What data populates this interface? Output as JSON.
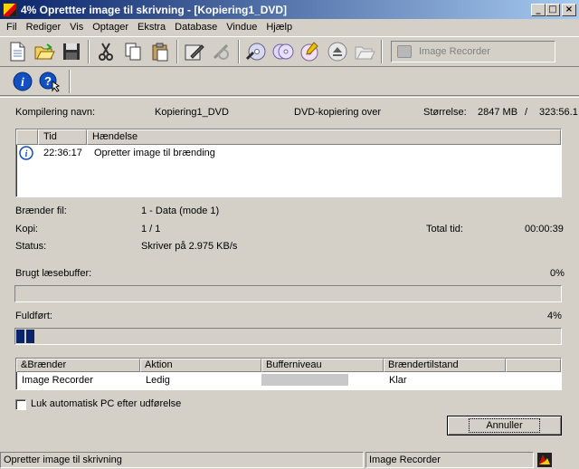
{
  "window": {
    "title": "4% Oprettter image til skrivning - [Kopiering1_DVD]"
  },
  "menu": [
    "Fil",
    "Rediger",
    "Vis",
    "Optager",
    "Ekstra",
    "Database",
    "Vindue",
    "Hjælp"
  ],
  "toolbar": {
    "recorder_label": "Image Recorder"
  },
  "info": {
    "compile_name_label": "Kompilering navn:",
    "compile_name_value": "Kopiering1_DVD",
    "mode_text": "DVD-kopiering over",
    "size_label": "Størrelse:",
    "size_value": "2847 MB",
    "size_sep": "/",
    "size_total": "323:56.1"
  },
  "log": {
    "columns": [
      "",
      "Tid",
      "Hændelse"
    ],
    "rows": [
      {
        "icon": "info-icon",
        "time": "22:36:17",
        "event": "Opretter image til brænding"
      }
    ]
  },
  "details": {
    "burner_file_label": "Brænder fil:",
    "burner_file_value": "1 - Data (mode 1)",
    "copy_label": "Kopi:",
    "copy_value": "1 / 1",
    "total_time_label": "Total tid:",
    "total_time_value": "00:00:39",
    "status_label": "Status:",
    "status_value": "Skriver på 2.975 KB/s"
  },
  "read_buffer": {
    "label": "Brugt læsebuffer:",
    "percent_text": "0%",
    "value": 0
  },
  "completed": {
    "label": "Fuldført:",
    "percent_text": "4%",
    "value": 4
  },
  "recorders": {
    "columns": [
      "&Brænder",
      "Aktion",
      "Bufferniveau",
      "Brændertilstand"
    ],
    "rows": [
      {
        "name": "Image Recorder",
        "action": "Ledig",
        "buffer": 0,
        "state": "Klar"
      }
    ]
  },
  "auto_shutdown": {
    "label": "Luk automatisk PC efter udførelse",
    "checked": false
  },
  "cancel_button": {
    "label": "Annuller"
  },
  "statusbar": {
    "left": "Opretter image til skrivning",
    "recorder": "Image Recorder"
  }
}
